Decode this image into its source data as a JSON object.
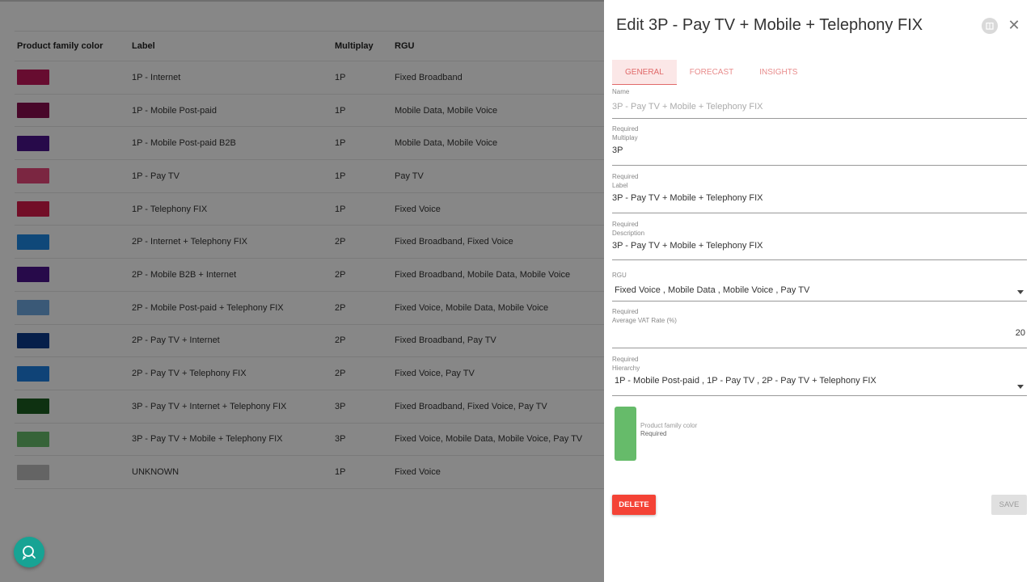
{
  "table": {
    "headers": {
      "color": "Product family color",
      "label": "Label",
      "multiplay": "Multiplay",
      "rgu": "RGU"
    },
    "rows": [
      {
        "color": "#c2185b",
        "label": "1P - Internet",
        "multiplay": "1P",
        "rgu": "Fixed Broadband"
      },
      {
        "color": "#880e4f",
        "label": "1P - Mobile Post-paid",
        "multiplay": "1P",
        "rgu": "Mobile Data, Mobile Voice"
      },
      {
        "color": "#4a148c",
        "label": "1P - Mobile Post-paid B2B",
        "multiplay": "1P",
        "rgu": "Mobile Data, Mobile Voice"
      },
      {
        "color": "#e8487c",
        "label": "1P - Pay TV",
        "multiplay": "1P",
        "rgu": "Pay TV"
      },
      {
        "color": "#d81b4a",
        "label": "1P - Telephony FIX",
        "multiplay": "1P",
        "rgu": "Fixed Voice"
      },
      {
        "color": "#1e88e5",
        "label": "2P - Internet + Telephony FIX",
        "multiplay": "2P",
        "rgu": "Fixed Broadband, Fixed Voice"
      },
      {
        "color": "#4a148c",
        "label": "2P - Mobile B2B + Internet",
        "multiplay": "2P",
        "rgu": "Fixed Broadband, Mobile Data, Mobile Voice"
      },
      {
        "color": "#6ea8e0",
        "label": "2P - Mobile Post-paid + Telephony FIX",
        "multiplay": "2P",
        "rgu": "Fixed Voice, Mobile Data, Mobile Voice"
      },
      {
        "color": "#0d3b8c",
        "label": "2P - Pay TV + Internet",
        "multiplay": "2P",
        "rgu": "Fixed Broadband, Pay TV"
      },
      {
        "color": "#1e7fe0",
        "label": "2P - Pay TV + Telephony FIX",
        "multiplay": "2P",
        "rgu": "Fixed Voice, Pay TV"
      },
      {
        "color": "#1b5e20",
        "label": "3P - Pay TV + Internet + Telephony FIX",
        "multiplay": "3P",
        "rgu": "Fixed Broadband, Fixed Voice, Pay TV"
      },
      {
        "color": "#66bb6a",
        "label": "3P - Pay TV + Mobile + Telephony FIX",
        "multiplay": "3P",
        "rgu": "Fixed Voice, Mobile Data, Mobile Voice, Pay TV"
      },
      {
        "color": "#bdbdbd",
        "label": "UNKNOWN",
        "multiplay": "1P",
        "rgu": "Fixed Voice"
      }
    ]
  },
  "drawer": {
    "title": "Edit 3P - Pay TV + Mobile + Telephony FIX",
    "tabs": [
      "GENERAL",
      "FORECAST",
      "INSIGHTS"
    ],
    "fields": {
      "name": {
        "label": "Name",
        "placeholder": "3P - Pay TV + Mobile + Telephony FIX"
      },
      "multiplay": {
        "required": "Required",
        "label": "Multiplay",
        "value": "3P"
      },
      "label": {
        "required": "Required",
        "label": "Label",
        "value": "3P - Pay TV + Mobile + Telephony FIX"
      },
      "description": {
        "required": "Required",
        "label": "Description",
        "value": "3P - Pay TV + Mobile + Telephony FIX"
      },
      "rgu": {
        "label": "RGU",
        "value": "Fixed Voice ,  Mobile Data ,  Mobile Voice ,  Pay TV"
      },
      "vat": {
        "required": "Required",
        "label": "Average VAT Rate (%)",
        "value": "20"
      },
      "hierarchy": {
        "required": "Required",
        "label": "Hierarchy",
        "value": "1P - Mobile Post-paid ,  1P - Pay TV ,  2P - Pay TV + Telephony FIX"
      },
      "color": {
        "label": "Product family color",
        "required": "Required",
        "value": "#66bb6a"
      }
    },
    "buttons": {
      "delete": "DELETE",
      "save": "SAVE"
    }
  },
  "icons": {
    "fab": "chat-search-icon",
    "header": "calendar-icon",
    "close": "close-icon"
  },
  "colors": {
    "accent": "#e06a6a",
    "delete": "#f44336",
    "fab": "#17a394"
  }
}
